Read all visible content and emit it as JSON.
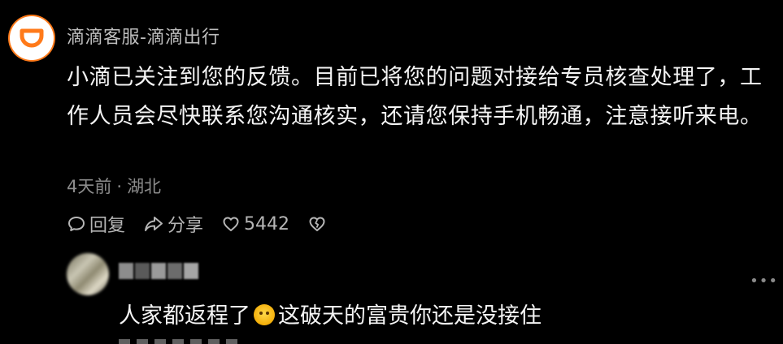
{
  "comment": {
    "author": "滴滴客服-滴滴出行",
    "text": "小滴已关注到您的反馈。目前已将您的问题对接给专员核查处理了，工作人员会尽快联系您沟通核实，还请您保持手机畅通，注意接听来电。",
    "time": "4天前",
    "separator": "·",
    "location": "湖北",
    "actions": {
      "reply_label": "回复",
      "share_label": "分享",
      "like_count": "5442"
    },
    "avatar_icon": "didi-logo-icon",
    "brand_color": "#ff7a1a"
  },
  "reply": {
    "text_before": "人家都返程了",
    "emoji": "crying-face-emoji",
    "text_after": "这破天的富贵你还是没接住"
  },
  "colors": {
    "background": "#000000",
    "body_text": "#f4f4f4",
    "meta_text": "#8c8c8c"
  }
}
